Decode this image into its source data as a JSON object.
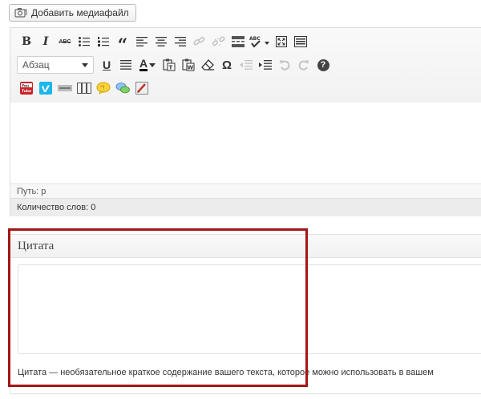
{
  "media_button": {
    "label": "Добавить медиафайл",
    "icon": "camera-music-icon"
  },
  "toolbar": {
    "format_select": {
      "value": "Абзац"
    },
    "bold_label": "B",
    "italic_label": "I",
    "strike_label": "ABC",
    "underline_label": "U",
    "text_color_label": "A",
    "omega_label": "Ω",
    "help_label": "?",
    "blockquote_label": "“",
    "colors": {
      "youtube_red": "#cc2229",
      "vimeo_blue": "#1ab7ea",
      "text_color": "#111111",
      "help_bg": "#444444"
    }
  },
  "status": {
    "path_label": "Путь: p",
    "word_count_label": "Количество слов: 0"
  },
  "excerpt": {
    "title": "Цитата",
    "value": "",
    "description": "Цитата — необязательное краткое содержание вашего текста, которое можно использовать в вашем"
  },
  "highlight_color": "#a31616"
}
